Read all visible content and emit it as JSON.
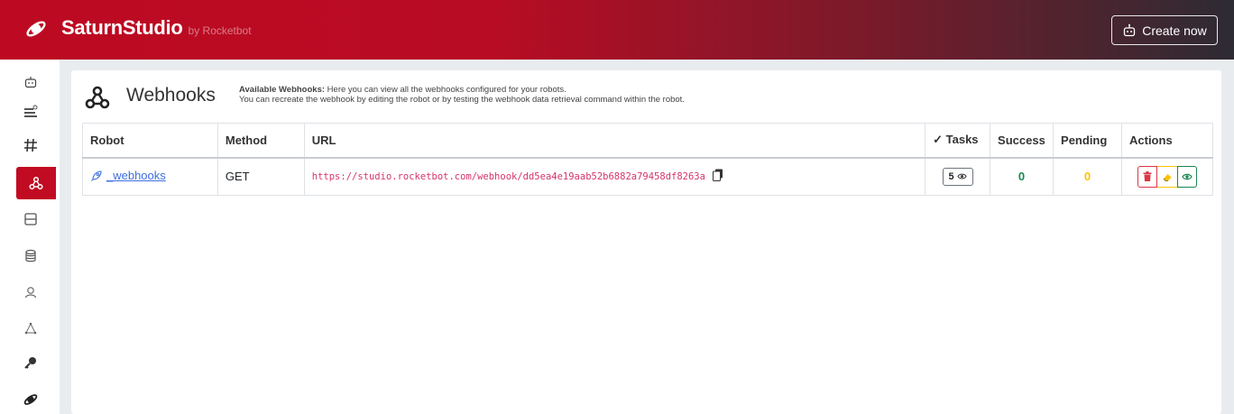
{
  "header": {
    "brand_name": "SaturnStudio",
    "brand_by": "by Rocketbot",
    "create_label": "Create now"
  },
  "sidebar": {
    "items": [
      {
        "icon": "robot-icon"
      },
      {
        "icon": "queue-icon"
      },
      {
        "icon": "hash-icon"
      },
      {
        "icon": "webhook-icon",
        "active": true
      },
      {
        "icon": "form-icon"
      },
      {
        "icon": "database-icon"
      },
      {
        "icon": "users-icon"
      },
      {
        "icon": "network-icon"
      },
      {
        "icon": "key-icon"
      },
      {
        "icon": "saturn-icon"
      }
    ]
  },
  "page": {
    "title": "Webhooks",
    "desc_bold": "Available Webhooks:",
    "desc_line1": " Here you can view all the webhooks configured for your robots.",
    "desc_line2": "You can recreate the webhook by editing the robot or by testing the webhook data retrieval command within the robot."
  },
  "table": {
    "columns": {
      "robot": "Robot",
      "method": "Method",
      "url": "URL",
      "tasks": "Tasks",
      "success": "Success",
      "pending": "Pending",
      "actions": "Actions"
    },
    "rows": [
      {
        "robot": "_webhooks",
        "method": "GET",
        "url": "https://studio.rocketbot.com/webhook/dd5ea4e19aab52b6882a79458df8263a",
        "tasks": "5",
        "success": "0",
        "pending": "0"
      }
    ]
  },
  "colors": {
    "brand_red": "#bd0a22",
    "success": "#198754",
    "pending": "#ffc107",
    "danger": "#dc3545",
    "url": "#d6336c"
  }
}
